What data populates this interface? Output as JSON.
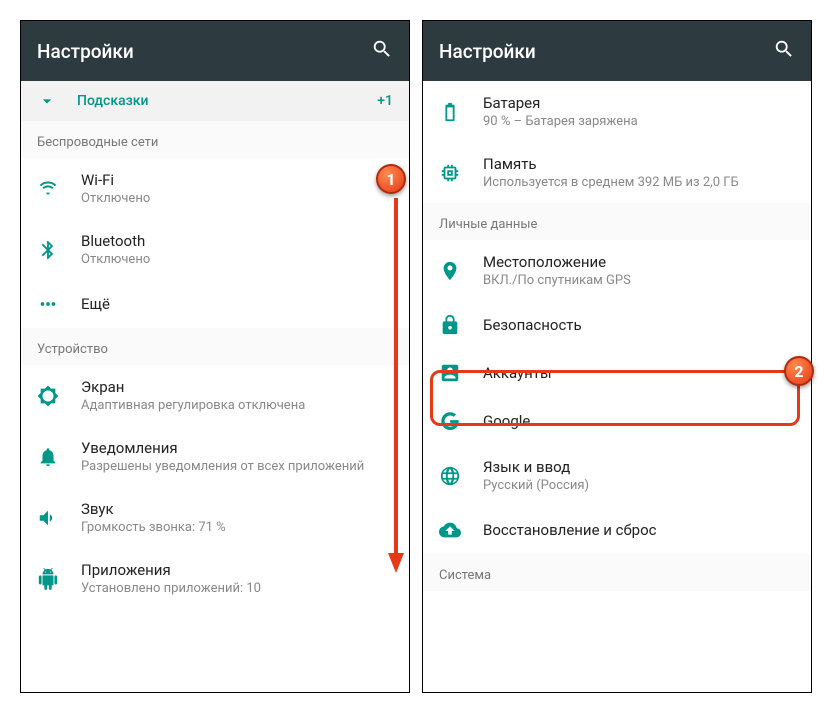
{
  "left": {
    "title": "Настройки",
    "hints": {
      "label": "Подсказки",
      "count": "+1"
    },
    "section_wireless": "Беспроводные сети",
    "wifi": {
      "title": "Wi-Fi",
      "subtitle": "Отключено"
    },
    "bluetooth": {
      "title": "Bluetooth",
      "subtitle": "Отключено"
    },
    "more": {
      "title": "Ещё"
    },
    "section_device": "Устройство",
    "display": {
      "title": "Экран",
      "subtitle": "Адаптивная регулировка отключена"
    },
    "notifications": {
      "title": "Уведомления",
      "subtitle": "Разрешены уведомления от всех приложений"
    },
    "sound": {
      "title": "Звук",
      "subtitle": "Громкость звонка: 71 %"
    },
    "apps": {
      "title": "Приложения",
      "subtitle": "Установлено приложений: 10"
    }
  },
  "right": {
    "title": "Настройки",
    "battery": {
      "title": "Батарея",
      "subtitle": "90 % – Батарея заряжена"
    },
    "memory": {
      "title": "Память",
      "subtitle": "Используется в среднем 392 МБ из 2,0 ГБ"
    },
    "section_personal": "Личные данные",
    "location": {
      "title": "Местоположение",
      "subtitle": "ВКЛ./По спутникам GPS"
    },
    "security": {
      "title": "Безопасность"
    },
    "accounts": {
      "title": "Аккаунты"
    },
    "google": {
      "title": "Google"
    },
    "language": {
      "title": "Язык и ввод",
      "subtitle": "Русский (Россия)"
    },
    "backup": {
      "title": "Восстановление и сброс"
    },
    "section_system": "Система"
  },
  "badges": {
    "one": "1",
    "two": "2"
  }
}
